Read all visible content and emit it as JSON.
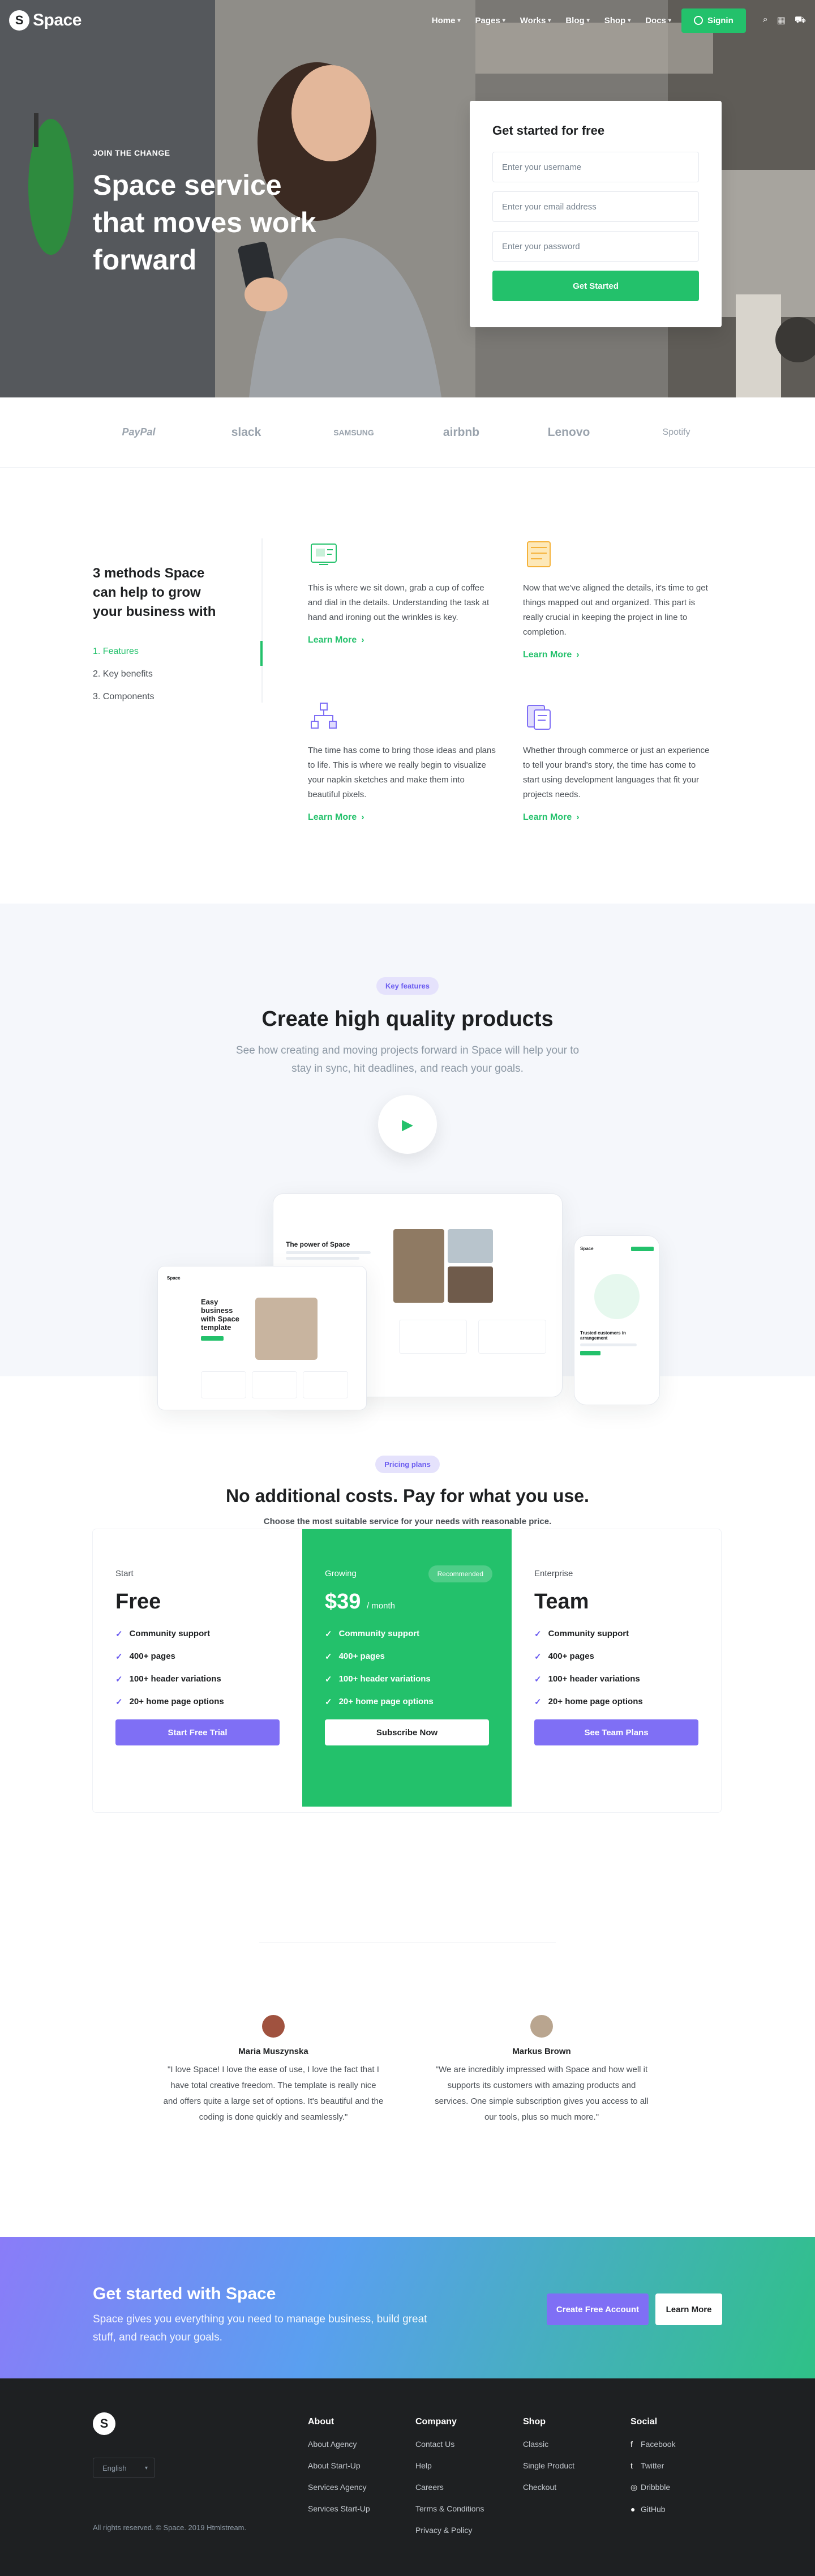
{
  "nav": {
    "brand": "Space",
    "logo_mark": "S",
    "links": [
      "Home",
      "Pages",
      "Works",
      "Blog",
      "Shop",
      "Docs"
    ],
    "signin": "Signin",
    "icons": [
      "search-icon",
      "grid-icon",
      "cart-icon"
    ]
  },
  "hero": {
    "kicker": "JOIN THE CHANGE",
    "title": "Space service that moves work forward",
    "form": {
      "title": "Get started for free",
      "username_placeholder": "Enter your username",
      "email_placeholder": "Enter your email address",
      "password_placeholder": "Enter your password",
      "submit": "Get Started"
    }
  },
  "brands": [
    "PayPal",
    "slack",
    "SAMSUNG",
    "airbnb",
    "Lenovo",
    "Spotify"
  ],
  "methods": {
    "title": "3 methods Space can help to grow your business with",
    "tabs": [
      "1. Features",
      "2. Key benefits",
      "3. Components"
    ],
    "features": [
      {
        "icon": "design-icon",
        "text": "This is where we sit down, grab a cup of coffee and dial in the details. Understanding the task at hand and ironing out the wrinkles is key.",
        "link": "Learn More"
      },
      {
        "icon": "layout-icon",
        "text": "Now that we've aligned the details, it's time to get things mapped out and organized. This part is really crucial in keeping the project in line to completion.",
        "link": "Learn More"
      },
      {
        "icon": "structure-icon",
        "text": "The time has come to bring those ideas and plans to life. This is where we really begin to visualize your napkin sketches and make them into beautiful pixels.",
        "link": "Learn More"
      },
      {
        "icon": "document-icon",
        "text": "Whether through commerce or just an experience to tell your brand's story, the time has come to start using development languages that fit your projects needs.",
        "link": "Learn More"
      }
    ]
  },
  "key_features": {
    "badge": "Key features",
    "title": "Create high quality products",
    "subtitle": "See how creating and moving projects forward in Space will help your to stay in sync, hit deadlines, and reach your goals.",
    "mock_desktop_title": "The power of Space",
    "mock_laptop_title": "Easy business with Space template",
    "mock_phone_title": "Trusted customers in arrangement",
    "mock_phone_brand": "Space"
  },
  "pricing": {
    "badge": "Pricing plans",
    "title": "No additional costs. Pay for what you use.",
    "subtitle": "Choose the most suitable service for your needs with reasonable price.",
    "plans": [
      {
        "name": "Start",
        "price": "Free",
        "features": [
          "Community support",
          "400+ pages",
          "100+ header variations",
          "20+ home page options"
        ],
        "button": "Start Free Trial"
      },
      {
        "name": "Growing",
        "price": "$39",
        "period": "/ month",
        "badge": "Recommended",
        "features": [
          "Community support",
          "400+ pages",
          "100+ header variations",
          "20+ home page options"
        ],
        "button": "Subscribe Now"
      },
      {
        "name": "Enterprise",
        "price": "Team",
        "features": [
          "Community support",
          "400+ pages",
          "100+ header variations",
          "20+ home page options"
        ],
        "button": "See Team Plans"
      }
    ]
  },
  "testimonials": [
    {
      "name": "Maria Muszynska",
      "quote": "\"I love Space! I love the ease of use, I love the fact that I have total creative freedom. The template is really nice and offers quite a large set of options. It's beautiful and the coding is done quickly and seamlessly.\""
    },
    {
      "name": "Markus Brown",
      "quote": "\"We are incredibly impressed with Space and how well it supports its customers with amazing products and services. One simple subscription gives you access to all our tools, plus so much more.\""
    }
  ],
  "cta": {
    "title": "Get started with Space",
    "subtitle": "Space gives you everything you need to manage business, build great stuff, and reach your goals.",
    "primary": "Create Free Account",
    "secondary": "Learn More"
  },
  "footer": {
    "logo_mark": "S",
    "language": "English",
    "copyright": "All rights reserved. © Space. 2019 Htmlstream.",
    "columns": [
      {
        "title": "About",
        "links": [
          "About Agency",
          "About Start-Up",
          "Services Agency",
          "Services Start-Up"
        ]
      },
      {
        "title": "Company",
        "links": [
          "Contact Us",
          "Help",
          "Careers",
          "Terms & Conditions",
          "Privacy & Policy"
        ]
      },
      {
        "title": "Shop",
        "links": [
          "Classic",
          "Single Product",
          "Checkout"
        ]
      },
      {
        "title": "Social",
        "links": [
          "Facebook",
          "Twitter",
          "Dribbble",
          "GitHub"
        ]
      }
    ]
  },
  "colors": {
    "accent": "#23c16b",
    "purple": "#7f6ff5",
    "dark": "#1e2022"
  }
}
